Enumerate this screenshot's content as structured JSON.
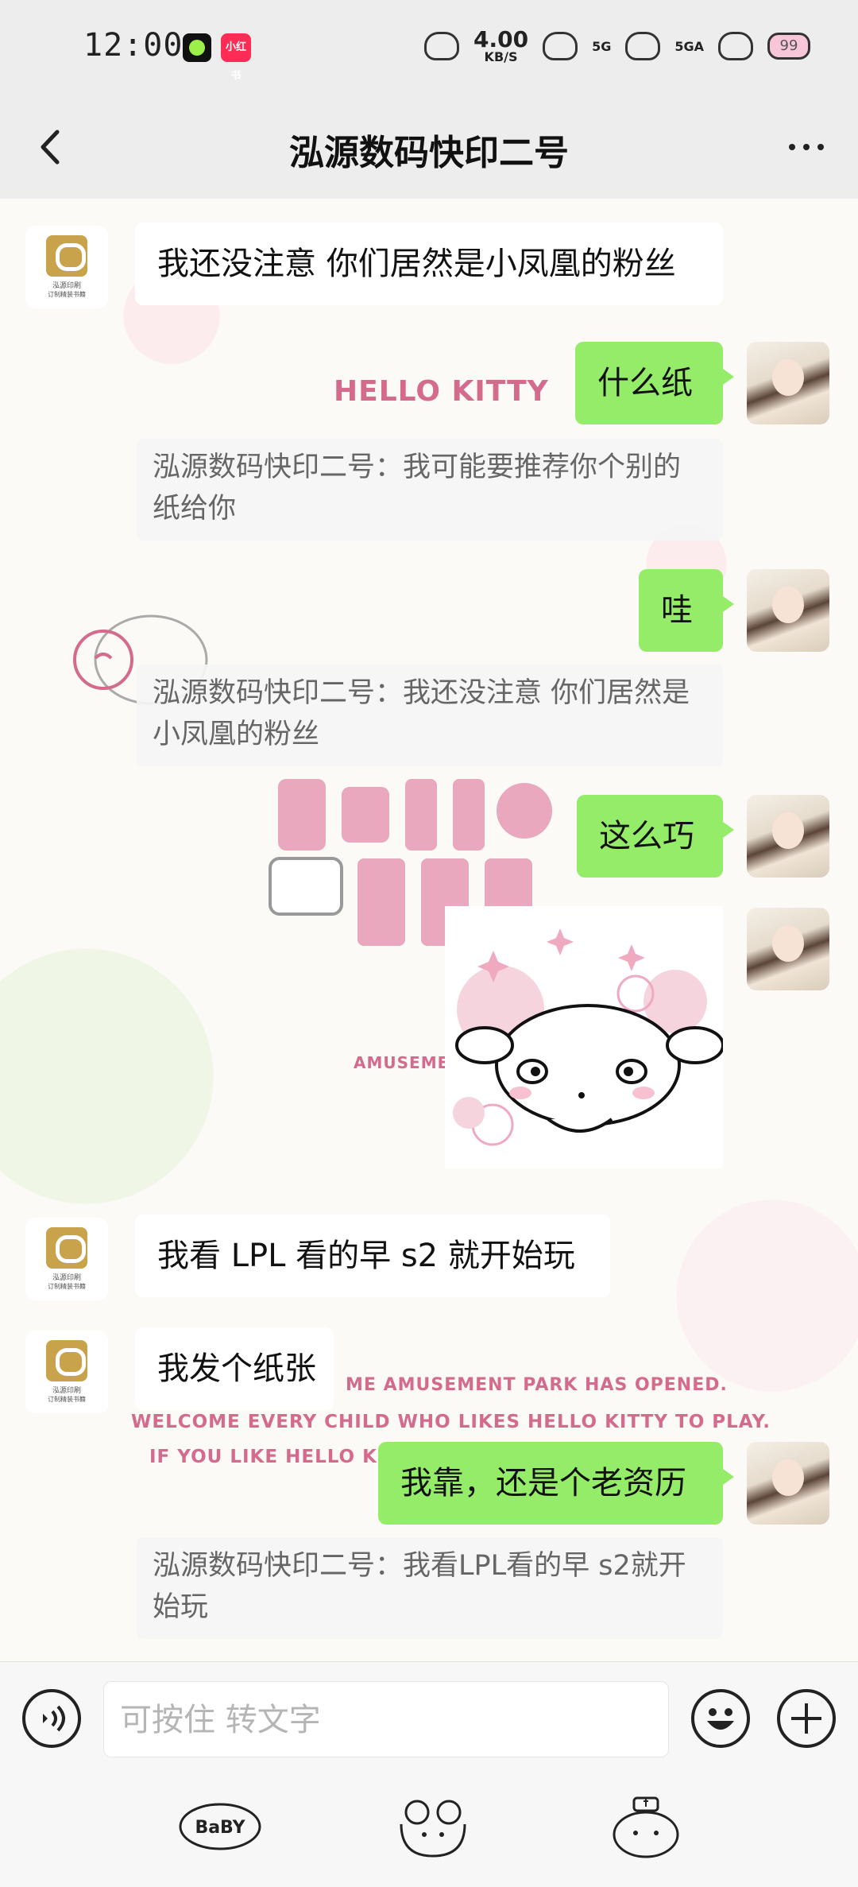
{
  "status_bar": {
    "time": "12:00",
    "app_badge": "小红书",
    "net_speed_value": "4.00",
    "net_speed_unit": "KB/S",
    "signal_1": "5G",
    "signal_2": "5GA",
    "battery": "99"
  },
  "header": {
    "title": "泓源数码快印二号"
  },
  "contact_avatar": {
    "line1": "泓源印刷",
    "line2": "订制精装书籍"
  },
  "messages": [
    {
      "from": "contact",
      "text": "我还没注意 你们居然是小凤凰的粉丝"
    },
    {
      "from": "self",
      "text": "什么纸",
      "quote": "泓源数码快印二号：我可能要推荐你个别的纸给你"
    },
    {
      "from": "self",
      "text": "哇",
      "quote": "泓源数码快印二号：我还没注意 你们居然是小凤凰的粉丝"
    },
    {
      "from": "self",
      "text": "这么巧"
    },
    {
      "from": "self",
      "sticker": "puppy-sticker"
    },
    {
      "from": "contact",
      "text": "我看 LPL 看的早 s2 就开始玩"
    },
    {
      "from": "contact",
      "text": "我发个纸张"
    },
    {
      "from": "self",
      "text": "我靠，还是个老资历",
      "quote": "泓源数码快印二号：我看LPL看的早 s2就开始玩"
    }
  ],
  "wallpaper": {
    "text1": "HELLO KITTY",
    "text2": "AMUSEMEN",
    "text3": "ME AMUSEMENT PARK HAS OPENED.",
    "text4": "WELCOME EVERY CHILD WHO LIKES HELLO KITTY TO PLAY.",
    "text5": "IF YOU LIKE HELLO KIT"
  },
  "input_bar": {
    "placeholder": "可按住 转文字"
  },
  "bottom_tabs": {
    "tab1": "BaBY"
  },
  "colors": {
    "outgoing_bubble": "#95ec69",
    "incoming_bubble": "#ffffff",
    "brand_logo": "#c9a34c"
  }
}
